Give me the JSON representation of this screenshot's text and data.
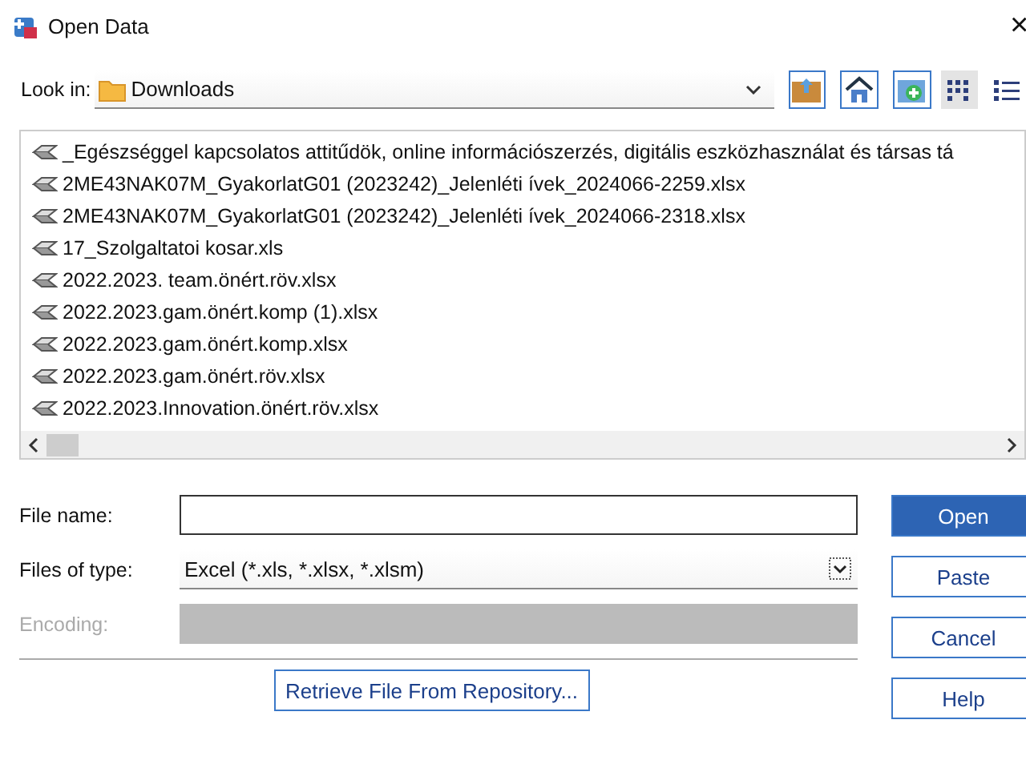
{
  "window": {
    "title": "Open Data",
    "close": "×"
  },
  "look_in": {
    "label": "Look in:",
    "value": "Downloads"
  },
  "toolbar": [
    {
      "kind": "up",
      "selected": false
    },
    {
      "kind": "home",
      "selected": false
    },
    {
      "kind": "new",
      "selected": false
    },
    {
      "kind": "list",
      "selected": true
    },
    {
      "kind": "details",
      "selected": false
    }
  ],
  "files": [
    {
      "name": "_Egészséggel kapcsolatos attitűdök, online információszerzés, digitális eszközhasználat és társas tá"
    },
    {
      "name": "2ME43NAK07M_GyakorlatG01 (2023242)_Jelenléti ívek_2024066-2259.xlsx"
    },
    {
      "name": "2ME43NAK07M_GyakorlatG01 (2023242)_Jelenléti ívek_2024066-2318.xlsx"
    },
    {
      "name": "17_Szolgaltatoi kosar.xls"
    },
    {
      "name": "2022.2023. team.önért.röv.xlsx"
    },
    {
      "name": "2022.2023.gam.önért.komp (1).xlsx"
    },
    {
      "name": "2022.2023.gam.önért.komp.xlsx"
    },
    {
      "name": "2022.2023.gam.önért.röv.xlsx"
    },
    {
      "name": "2022.2023.Innovation.önért.röv.xlsx"
    }
  ],
  "fields": [
    {
      "kind": "input",
      "label": "File name:",
      "disabled": false
    },
    {
      "kind": "select",
      "label": "Files of type:",
      "value": "Excel (*.xls, *.xlsx, *.xlsm)",
      "disabled": false
    },
    {
      "kind": "input",
      "label": "Encoding:",
      "disabled": true
    }
  ],
  "buttons": [
    {
      "label": "Open",
      "default": true
    },
    {
      "label": "Paste",
      "default": false
    },
    {
      "label": "Cancel",
      "default": false
    },
    {
      "label": "Help",
      "default": false
    }
  ],
  "repository_button": {
    "label": "Retrieve File From Repository..."
  }
}
